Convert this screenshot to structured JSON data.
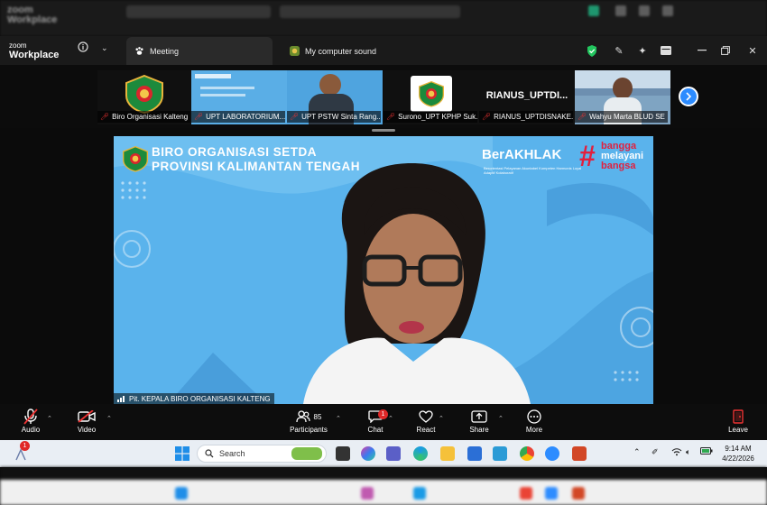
{
  "window": {
    "brand_line1": "zoom",
    "brand_line2": "Workplace",
    "tabs": [
      {
        "label": "Meeting",
        "icon": "paw-icon"
      },
      {
        "label": "My computer sound",
        "icon": "speaker-app-icon"
      }
    ]
  },
  "thumbnails": [
    {
      "name": "Biro Organisasi Kalteng",
      "muted": true
    },
    {
      "name": "UPT LABORATORIUM...",
      "muted": true
    },
    {
      "name": "UPT PSTW Sinta Rang...",
      "muted": true
    },
    {
      "name": "Surono_UPT KPHP Suk...",
      "muted": true
    },
    {
      "name": "RIANUS_UPTDISNAKE...",
      "muted": true,
      "display_text": "RIANUS_UPTDI..."
    },
    {
      "name": "Wahyu Marta BLUD SE",
      "muted": true
    }
  ],
  "main_video": {
    "speaker": "Pit. KEPALA BIRO ORGANISASI KALTENG",
    "banner_line1": "BIRO ORGANISASI SETDA",
    "banner_line2": "PROVINSI KALIMANTAN TENGAH",
    "akhlak": "BerAKHLAK",
    "akhlak_sub": "Berorientasi Pelayanan Akuntabel Kompeten Harmonis Loyal Adaptif Kolaboratif",
    "bangga": [
      "bangga",
      "melayani",
      "bangsa"
    ]
  },
  "toolbar": {
    "audio": "Audio",
    "video": "Video",
    "participants": "Participants",
    "participants_count": "85",
    "chat": "Chat",
    "chat_badge": "1",
    "react": "React",
    "share": "Share",
    "more": "More",
    "leave": "Leave"
  },
  "taskbar": {
    "search_placeholder": "Search",
    "notification_badge": "1",
    "time": "9:14 AM",
    "date": "4/22/2026"
  },
  "colors": {
    "zoom_blue": "#2d8cff",
    "main_bg": "#56b1ea",
    "mute_red": "#e33333",
    "banner_red": "#e21f3d"
  }
}
